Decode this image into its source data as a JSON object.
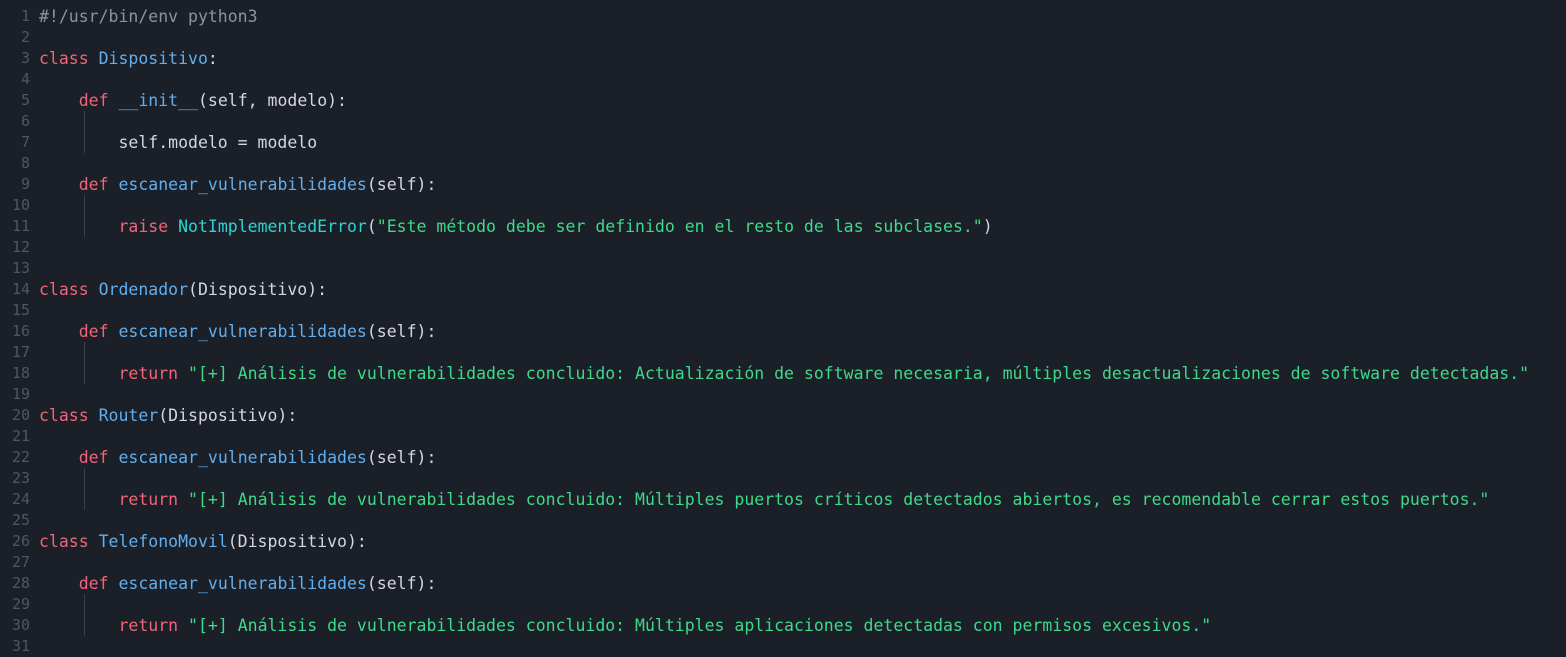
{
  "colors": {
    "background": "#1b1f27",
    "keyword": "#f0657a",
    "class_name": "#61afef",
    "function_name": "#61afef",
    "builtin": "#2ad4d4",
    "string": "#3fd98a",
    "comment": "#8b93a3",
    "text": "#d4d7de",
    "line_number": "#4f5666"
  },
  "lines": [
    {
      "n": "1",
      "tokens": [
        {
          "t": "cm",
          "v": "#!/usr/bin/env python3"
        }
      ]
    },
    {
      "n": "2",
      "tokens": []
    },
    {
      "n": "3",
      "tokens": [
        {
          "t": "kw",
          "v": "class"
        },
        {
          "t": "plain",
          "v": " "
        },
        {
          "t": "cls",
          "v": "Dispositivo"
        },
        {
          "t": "plain",
          "v": ":"
        }
      ]
    },
    {
      "n": "4",
      "tokens": []
    },
    {
      "n": "5",
      "tokens": [
        {
          "t": "plain",
          "v": "    "
        },
        {
          "t": "kw",
          "v": "def"
        },
        {
          "t": "plain",
          "v": " "
        },
        {
          "t": "fn",
          "v": "__init__"
        },
        {
          "t": "plain",
          "v": "(self, modelo):"
        }
      ]
    },
    {
      "n": "6",
      "tokens": []
    },
    {
      "n": "7",
      "tokens": [
        {
          "t": "plain",
          "v": "        self.modelo = modelo"
        }
      ]
    },
    {
      "n": "8",
      "tokens": []
    },
    {
      "n": "9",
      "tokens": [
        {
          "t": "plain",
          "v": "    "
        },
        {
          "t": "kw",
          "v": "def"
        },
        {
          "t": "plain",
          "v": " "
        },
        {
          "t": "fn",
          "v": "escanear_vulnerabilidades"
        },
        {
          "t": "plain",
          "v": "(self):"
        }
      ]
    },
    {
      "n": "10",
      "tokens": []
    },
    {
      "n": "11",
      "tokens": [
        {
          "t": "plain",
          "v": "        "
        },
        {
          "t": "kw",
          "v": "raise"
        },
        {
          "t": "plain",
          "v": " "
        },
        {
          "t": "builtin",
          "v": "NotImplementedError"
        },
        {
          "t": "plain",
          "v": "("
        },
        {
          "t": "str",
          "v": "\"Este método debe ser definido en el resto de las subclases.\""
        },
        {
          "t": "plain",
          "v": ")"
        }
      ]
    },
    {
      "n": "12",
      "tokens": []
    },
    {
      "n": "13",
      "tokens": []
    },
    {
      "n": "14",
      "tokens": [
        {
          "t": "kw",
          "v": "class"
        },
        {
          "t": "plain",
          "v": " "
        },
        {
          "t": "cls",
          "v": "Ordenador"
        },
        {
          "t": "plain",
          "v": "(Dispositivo):"
        }
      ]
    },
    {
      "n": "15",
      "tokens": []
    },
    {
      "n": "16",
      "tokens": [
        {
          "t": "plain",
          "v": "    "
        },
        {
          "t": "kw",
          "v": "def"
        },
        {
          "t": "plain",
          "v": " "
        },
        {
          "t": "fn",
          "v": "escanear_vulnerabilidades"
        },
        {
          "t": "plain",
          "v": "(self):"
        }
      ]
    },
    {
      "n": "17",
      "tokens": []
    },
    {
      "n": "18",
      "tokens": [
        {
          "t": "plain",
          "v": "        "
        },
        {
          "t": "kw",
          "v": "return"
        },
        {
          "t": "plain",
          "v": " "
        },
        {
          "t": "str",
          "v": "\"[+] Análisis de vulnerabilidades concluido: Actualización de software necesaria, múltiples desactualizaciones de software detectadas.\""
        }
      ]
    },
    {
      "n": "19",
      "tokens": []
    },
    {
      "n": "20",
      "tokens": [
        {
          "t": "kw",
          "v": "class"
        },
        {
          "t": "plain",
          "v": " "
        },
        {
          "t": "cls",
          "v": "Router"
        },
        {
          "t": "plain",
          "v": "(Dispositivo):"
        }
      ]
    },
    {
      "n": "21",
      "tokens": []
    },
    {
      "n": "22",
      "tokens": [
        {
          "t": "plain",
          "v": "    "
        },
        {
          "t": "kw",
          "v": "def"
        },
        {
          "t": "plain",
          "v": " "
        },
        {
          "t": "fn",
          "v": "escanear_vulnerabilidades"
        },
        {
          "t": "plain",
          "v": "(self):"
        }
      ]
    },
    {
      "n": "23",
      "tokens": []
    },
    {
      "n": "24",
      "tokens": [
        {
          "t": "plain",
          "v": "        "
        },
        {
          "t": "kw",
          "v": "return"
        },
        {
          "t": "plain",
          "v": " "
        },
        {
          "t": "str",
          "v": "\"[+] Análisis de vulnerabilidades concluido: Múltiples puertos críticos detectados abiertos, es recomendable cerrar estos puertos.\""
        }
      ]
    },
    {
      "n": "25",
      "tokens": []
    },
    {
      "n": "26",
      "tokens": [
        {
          "t": "kw",
          "v": "class"
        },
        {
          "t": "plain",
          "v": " "
        },
        {
          "t": "cls",
          "v": "TelefonoMovil"
        },
        {
          "t": "plain",
          "v": "(Dispositivo):"
        }
      ]
    },
    {
      "n": "27",
      "tokens": []
    },
    {
      "n": "28",
      "tokens": [
        {
          "t": "plain",
          "v": "    "
        },
        {
          "t": "kw",
          "v": "def"
        },
        {
          "t": "plain",
          "v": " "
        },
        {
          "t": "fn",
          "v": "escanear_vulnerabilidades"
        },
        {
          "t": "plain",
          "v": "(self):"
        }
      ]
    },
    {
      "n": "29",
      "tokens": []
    },
    {
      "n": "30",
      "tokens": [
        {
          "t": "plain",
          "v": "        "
        },
        {
          "t": "kw",
          "v": "return"
        },
        {
          "t": "plain",
          "v": " "
        },
        {
          "t": "str",
          "v": "\"[+] Análisis de vulnerabilidades concluido: Múltiples aplicaciones detectadas con permisos excesivos.\""
        }
      ]
    },
    {
      "n": "31",
      "tokens": []
    }
  ]
}
